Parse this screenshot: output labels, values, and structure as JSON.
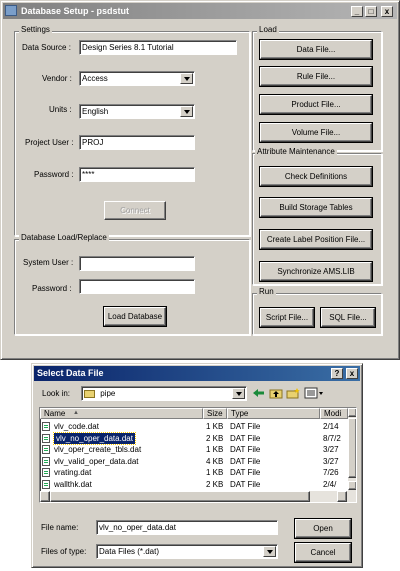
{
  "setup_window": {
    "title": "Database Setup - psdstut",
    "titlebar_buttons": {
      "minimize": "_",
      "maximize": "□",
      "close": "x"
    },
    "settings": {
      "group_label": "Settings",
      "data_source_label": "Data Source :",
      "data_source_value": "Design Series 8.1 Tutorial",
      "vendor_label": "Vendor :",
      "vendor_value": "Access",
      "units_label": "Units :",
      "units_value": "English",
      "project_user_label": "Project User :",
      "project_user_value": "PROJ",
      "password_label": "Password :",
      "password_value": "****",
      "connect_label": "Connect"
    },
    "load_replace": {
      "group_label": "Database Load/Replace",
      "system_user_label": "System User :",
      "system_user_value": "",
      "password_label": "Password :",
      "password_value": "",
      "load_database_label": "Load Database"
    },
    "load": {
      "group_label": "Load",
      "buttons": [
        "Data File...",
        "Rule File...",
        "Product File...",
        "Volume File..."
      ]
    },
    "attribute_maintenance": {
      "group_label": "Attribute Maintenance",
      "buttons": [
        "Check Definitions",
        "Build Storage Tables",
        "Create Label Position File...",
        "Synchronize AMS.LIB"
      ]
    },
    "run": {
      "group_label": "Run",
      "script_label": "Script File...",
      "sql_label": "SQL File..."
    }
  },
  "file_dialog": {
    "title": "Select Data File",
    "help_button": "?",
    "close_button": "x",
    "look_in_label": "Look in:",
    "look_in_value": "pipe",
    "columns": {
      "name": "Name",
      "size": "Size",
      "type": "Type",
      "modified": "Modi"
    },
    "sort_indicator": "▲",
    "files": [
      {
        "name": "vlv_code.dat",
        "size": "1 KB",
        "type": "DAT File",
        "modified": "2/14",
        "selected": false
      },
      {
        "name": "vlv_no_oper_data.dat",
        "size": "2 KB",
        "type": "DAT File",
        "modified": "8/7/2",
        "selected": true
      },
      {
        "name": "vlv_oper_create_tbls.dat",
        "size": "1 KB",
        "type": "DAT File",
        "modified": "3/27",
        "selected": false
      },
      {
        "name": "vlv_valid_oper_data.dat",
        "size": "4 KB",
        "type": "DAT File",
        "modified": "3/27",
        "selected": false
      },
      {
        "name": "vrating.dat",
        "size": "1 KB",
        "type": "DAT File",
        "modified": "7/26",
        "selected": false
      },
      {
        "name": "wallthk.dat",
        "size": "2 KB",
        "type": "DAT File",
        "modified": "2/4/",
        "selected": false
      }
    ],
    "file_name_label": "File name:",
    "file_name_value": "vlv_no_oper_data.dat",
    "files_of_type_label": "Files of type:",
    "files_of_type_value": "Data Files (*.dat)",
    "open_label": "Open",
    "cancel_label": "Cancel"
  },
  "colors": {
    "window_face": "#d4d0c8",
    "titlebar_active": "#0a246a",
    "titlebar_inactive": "#808080",
    "selection": "#0a246a"
  }
}
